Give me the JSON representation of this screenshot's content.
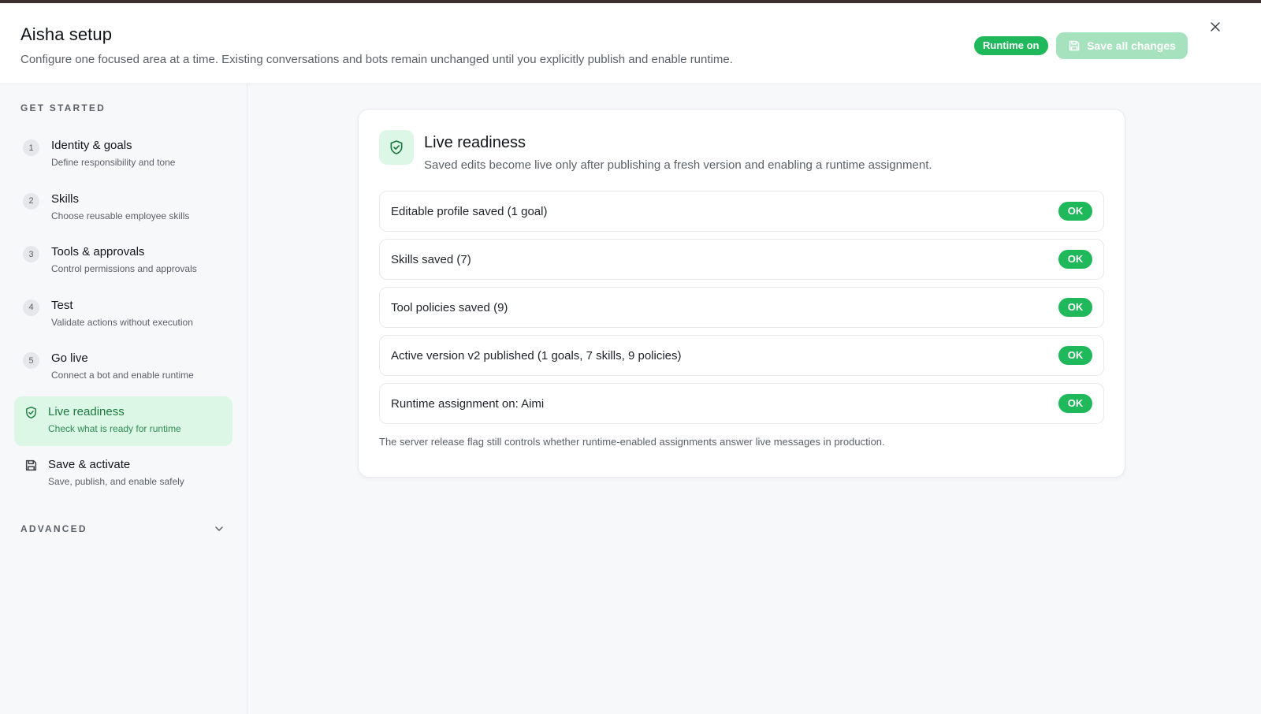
{
  "header": {
    "title": "Aisha setup",
    "subtitle": "Configure one focused area at a time. Existing conversations and bots remain unchanged until you explicitly publish and enable runtime.",
    "runtime_badge": "Runtime on",
    "save_all_label": "Save all changes",
    "close_icon": "close-icon"
  },
  "sidebar": {
    "section_label": "GET STARTED",
    "items": [
      {
        "number": "1",
        "title": "Identity & goals",
        "desc": "Define responsibility and tone"
      },
      {
        "number": "2",
        "title": "Skills",
        "desc": "Choose reusable employee skills"
      },
      {
        "number": "3",
        "title": "Tools & approvals",
        "desc": "Control permissions and approvals"
      },
      {
        "number": "4",
        "title": "Test",
        "desc": "Validate actions without execution"
      },
      {
        "number": "5",
        "title": "Go live",
        "desc": "Connect a bot and enable runtime"
      },
      {
        "icon": "shield-check-icon",
        "title": "Live readiness",
        "desc": "Check what is ready for runtime",
        "active": true
      },
      {
        "icon": "save-icon",
        "title": "Save & activate",
        "desc": "Save, publish, and enable safely"
      }
    ],
    "advanced_label": "ADVANCED"
  },
  "card": {
    "icon": "shield-check-icon",
    "title": "Live readiness",
    "subtitle": "Saved edits become live only after publishing a fresh version and enabling a runtime assignment.",
    "checks": [
      {
        "label": "Editable profile saved (1 goal)",
        "status": "OK"
      },
      {
        "label": "Skills saved (7)",
        "status": "OK"
      },
      {
        "label": "Tool policies saved (9)",
        "status": "OK"
      },
      {
        "label": "Active version v2 published (1 goals, 7 skills, 9 policies)",
        "status": "OK"
      },
      {
        "label": "Runtime assignment on: Aimi",
        "status": "OK"
      }
    ],
    "note": "The server release flag still controls whether runtime-enabled assignments answer live messages in production."
  },
  "colors": {
    "accent": "#1fb85a",
    "accent_light": "#dcf7e5",
    "save_disabled": "#a6e2bd"
  }
}
